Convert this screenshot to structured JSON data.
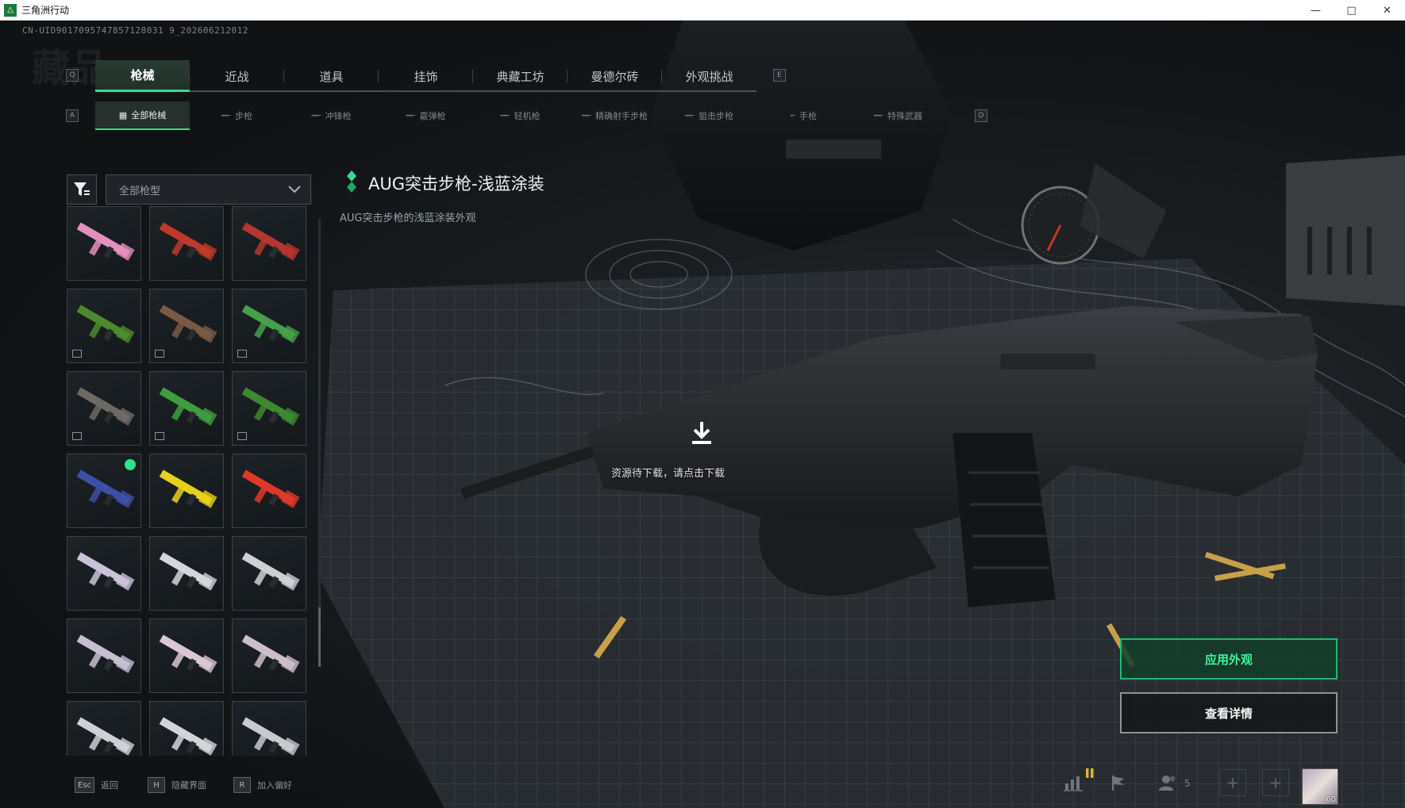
{
  "window": {
    "title": "三角洲行动",
    "min_glyph": "—",
    "max_glyph": "□",
    "close_glyph": "✕"
  },
  "uid": "CN-UID9017095747857128031 9_202606212012",
  "ghost_title": "藏品",
  "keys": {
    "main_left": "Q",
    "main_right": "E",
    "sub_left": "A",
    "sub_right": "D"
  },
  "main_tabs": [
    {
      "label": "枪械",
      "active": true
    },
    {
      "label": "近战"
    },
    {
      "label": "道具"
    },
    {
      "label": "挂饰"
    },
    {
      "label": "典藏工坊"
    },
    {
      "label": "曼德尔砖"
    },
    {
      "label": "外观挑战"
    }
  ],
  "sub_tabs": [
    {
      "label": "全部枪械",
      "active": true
    },
    {
      "label": "步枪"
    },
    {
      "label": "冲锋枪"
    },
    {
      "label": "霰弹枪"
    },
    {
      "label": "轻机枪"
    },
    {
      "label": "精确射手步枪"
    },
    {
      "label": "狙击步枪"
    },
    {
      "label": "手枪"
    },
    {
      "label": "特殊武器"
    }
  ],
  "filter": {
    "dropdown_value": "全部枪型"
  },
  "skin_grid": [
    {
      "color": "#e58fbd"
    },
    {
      "color": "#c0392b"
    },
    {
      "color": "#b5362e"
    },
    {
      "color": "#4c8a2e",
      "locked": true
    },
    {
      "color": "#7a5a45",
      "locked": true
    },
    {
      "color": "#45a04a",
      "locked": true
    },
    {
      "color": "#6d6a64",
      "locked": true
    },
    {
      "color": "#3f9d3f",
      "locked": true
    },
    {
      "color": "#3c8a30",
      "locked": true
    },
    {
      "color": "#3e4fa8",
      "selected": true
    },
    {
      "color": "#e6d11b"
    },
    {
      "color": "#e0382a"
    },
    {
      "color": "#c9c2d8"
    },
    {
      "color": "#d4d6dc"
    },
    {
      "color": "#cfd0d4"
    },
    {
      "color": "#c6bfd2"
    },
    {
      "color": "#d9c7d3"
    },
    {
      "color": "#cdbfc9"
    },
    {
      "color": "#cfcfd6"
    },
    {
      "color": "#d3d3da"
    },
    {
      "color": "#c9c9d0"
    }
  ],
  "item": {
    "title": "AUG突击步枪-浅蓝涂装",
    "description": "AUG突击步枪的浅蓝涂装外观"
  },
  "download": {
    "text": "资源待下载，请点击下载"
  },
  "actions": {
    "apply": "应用外观",
    "details": "查看详情"
  },
  "bottom_bar": [
    {
      "key": "Esc",
      "label": "返回"
    },
    {
      "key": "H",
      "label": "隐藏界面"
    },
    {
      "key": "R",
      "label": "加入偏好"
    }
  ],
  "status": {
    "friend_count": "5",
    "avatar_level": "60"
  },
  "colors": {
    "accent": "#2fe08a",
    "apply_border": "#23b86f"
  }
}
